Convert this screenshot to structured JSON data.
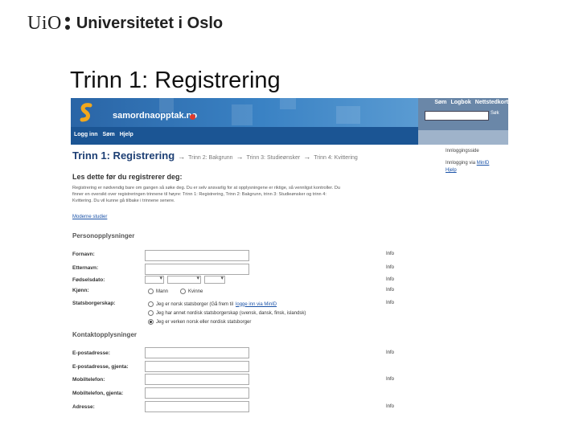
{
  "slide": {
    "logo_uio": "UiO",
    "logo_name": "Universitetet i Oslo",
    "title": "Trinn 1: Registrering"
  },
  "site": {
    "banner_text": "samordnaopptak.no",
    "top_links": [
      "Søm",
      "Logbok",
      "Nettstedkort"
    ],
    "search_button": "Søk",
    "nav_links": [
      "Logg inn",
      "Søm",
      "Hjelp"
    ]
  },
  "steps": {
    "active": "Trinn 1: Registrering",
    "others": [
      "Trinn 2: Bakgrunn",
      "Trinn 3: Studieønsker",
      "Trinn 4: Kvittering"
    ]
  },
  "sidebar": {
    "lines": [
      "Innloggingsside",
      "Innlogging via",
      "MinID",
      "Hjelp"
    ]
  },
  "intro": {
    "heading": "Les dette før du registrerer deg:",
    "text": "Registrering er nødvendig bare om gangen så søke deg. Du er selv ansvarlig for at opplysningene er riktige, så vennligst kontroller. Du finner en oversikt over registreringen trinnene til høyre: Trinn 1: Registrering, Trinn 2: Bakgrunn, trinn 3: Studieønsker og trinn 4: Kvittering. Du vil kunne gå tilbake i trinnene senere.",
    "link": "Moderne studier"
  },
  "personal": {
    "heading": "Personopplysninger",
    "fields": {
      "fornavn": "Fornavn:",
      "etternavn": "Etternavn:",
      "fodselsdato": "Fødselsdato:",
      "kjonn": "Kjønn:",
      "statsborger": "Statsborgerskap:"
    },
    "gender_options": [
      "Mann",
      "Kvinne"
    ],
    "citizenship_options": [
      "Jeg er norsk statsborger (Gå frem til",
      "logge inn via MinID",
      "Jeg har annet nordisk statsborgerskap (svensk, dansk, finsk, islandsk)",
      "Jeg er verken norsk eller nordisk statsborger"
    ]
  },
  "contact": {
    "heading": "Kontaktopplysninger",
    "fields": {
      "epost": "E-postadresse:",
      "epost_gjenta": "E-postadresse, gjenta:",
      "mobil": "Mobiltelefon:",
      "mobil_gjenta": "Mobiltelefon, gjenta:",
      "adresse": "Adresse:"
    }
  },
  "info_label": "Info",
  "colors": {
    "banner": "#2f6fb0",
    "navbar": "#1b5594",
    "heading": "#1d3f74",
    "link": "#1b53a8"
  }
}
